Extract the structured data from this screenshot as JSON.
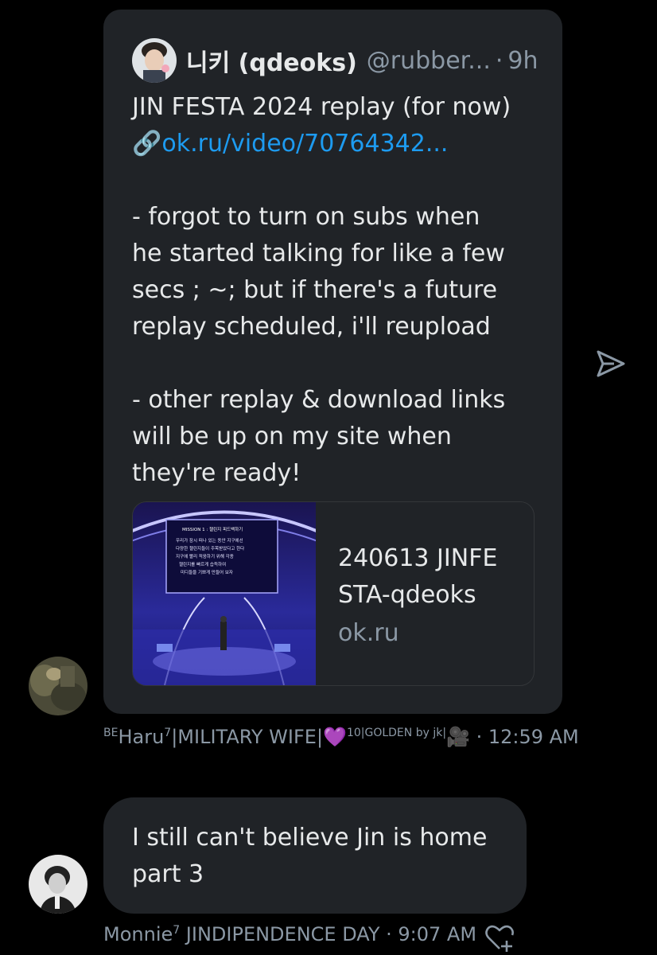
{
  "quote": {
    "display_name": "니키 (qdeoks)",
    "handle": "@rubber...",
    "time": "9h",
    "line1": "JIN FESTA 2024 replay (for now)",
    "link_icon": "🔗",
    "link_text": "ok.ru/video/70764342...",
    "para1": [
      "- forgot to turn on subs when",
      "he started talking for like a few",
      "secs ; ~; but if there's a future",
      "replay scheduled, i'll reupload"
    ],
    "para2": [
      "- other replay & download links",
      "will be up on my site when",
      "they're ready!"
    ],
    "card": {
      "title_lines": [
        "240613 JINFE",
        "STA-qdeoks"
      ],
      "domain": "ok.ru",
      "screen_lines": [
        "MISSION 1 : 챌린지 피드백하기",
        "우리가 잠시 떠나 있는 동안 지구에선",
        "다양한 챌린지들이 주목받았다고 한다",
        "지구에 빨리 적응하기 위해 각종",
        "챌린지를 빠르게 습득하여",
        "미디들을 기쁘게 만들어 보자"
      ]
    }
  },
  "message1": {
    "sender_prefix": "BE",
    "sender_name": "Haru",
    "sender_sup": "7",
    "sender_rest": "|MILITARY WIFE|",
    "heart_emoji": "💜",
    "num_sup": "10",
    "golden": "|GOLDEN by jk|",
    "camera_emoji": "🎥",
    "time": "12:59 AM"
  },
  "message2": {
    "text": "I still can't believe Jin is home part 3",
    "sender_name": "Monnie",
    "sender_sup": "7",
    "sender_rest": " JINDIPENDENCE DAY",
    "time": "9:07 AM"
  },
  "icons": {
    "send": "send-icon",
    "react": "heart-add-icon"
  },
  "colors": {
    "bubble": "#202327",
    "link": "#1d9bf0",
    "muted": "#8b98a5",
    "text": "#e7e9ea"
  }
}
